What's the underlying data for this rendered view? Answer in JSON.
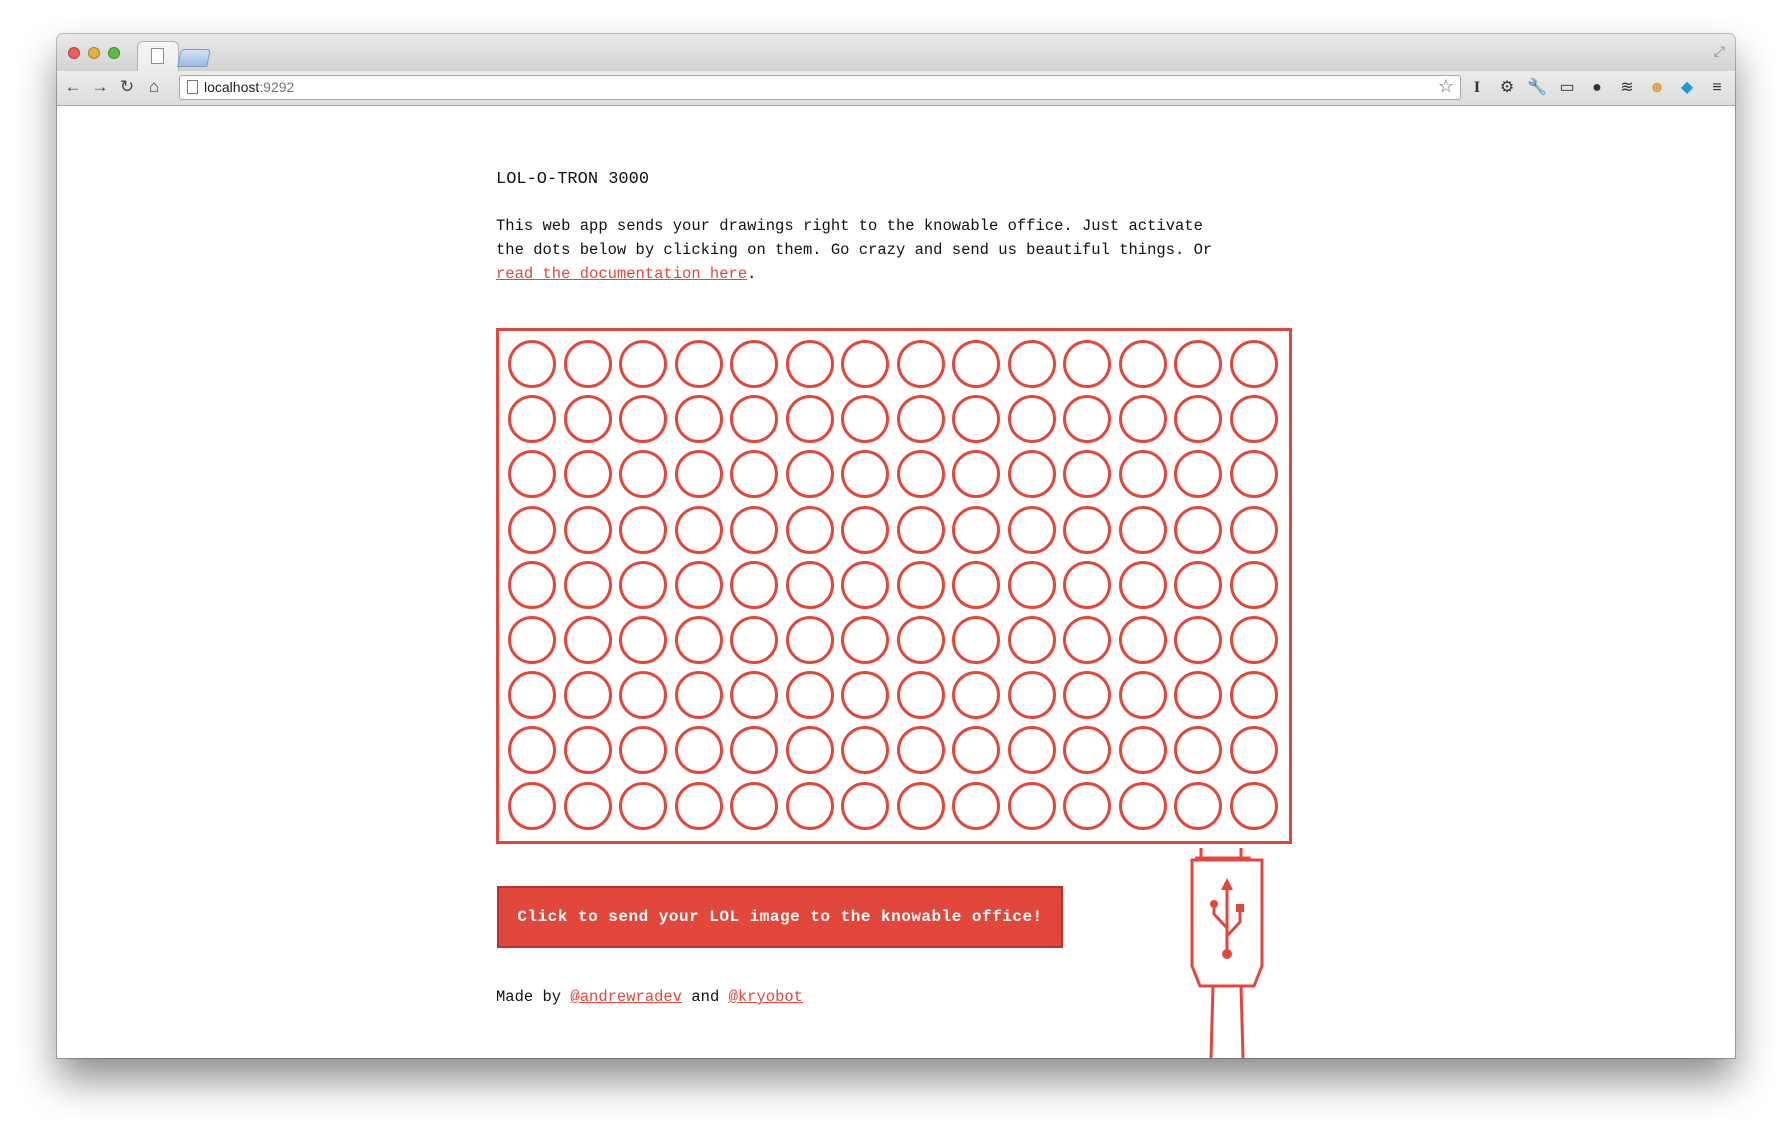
{
  "browser": {
    "url_host": "localhost",
    "url_port": ":9292",
    "nav": [
      "back-icon",
      "forward-icon",
      "reload-icon",
      "home-icon"
    ],
    "extensions": [
      "instapaper-icon",
      "gear-icon",
      "wrench-icon",
      "screenshot-icon",
      "circle-icon",
      "layers-icon",
      "cat-icon",
      "puzzle-icon",
      "menu-icon"
    ]
  },
  "page": {
    "title": "LOL-O-TRON 3000",
    "intro_text": "This web app sends your drawings right to the knowable office. Just activate the dots below by clicking on them. Go crazy and send us beautiful things. Or ",
    "intro_link": "read the documentation here",
    "intro_end": ".",
    "send_button": "Click to send your LOL image to the knowable office!",
    "credits_prefix": "Made by ",
    "credit_1": "@andrewradev",
    "credits_and": " and ",
    "credit_2": "@kryobot"
  },
  "grid": {
    "rows": 9,
    "cols": 14,
    "accent": "#e2473b"
  }
}
